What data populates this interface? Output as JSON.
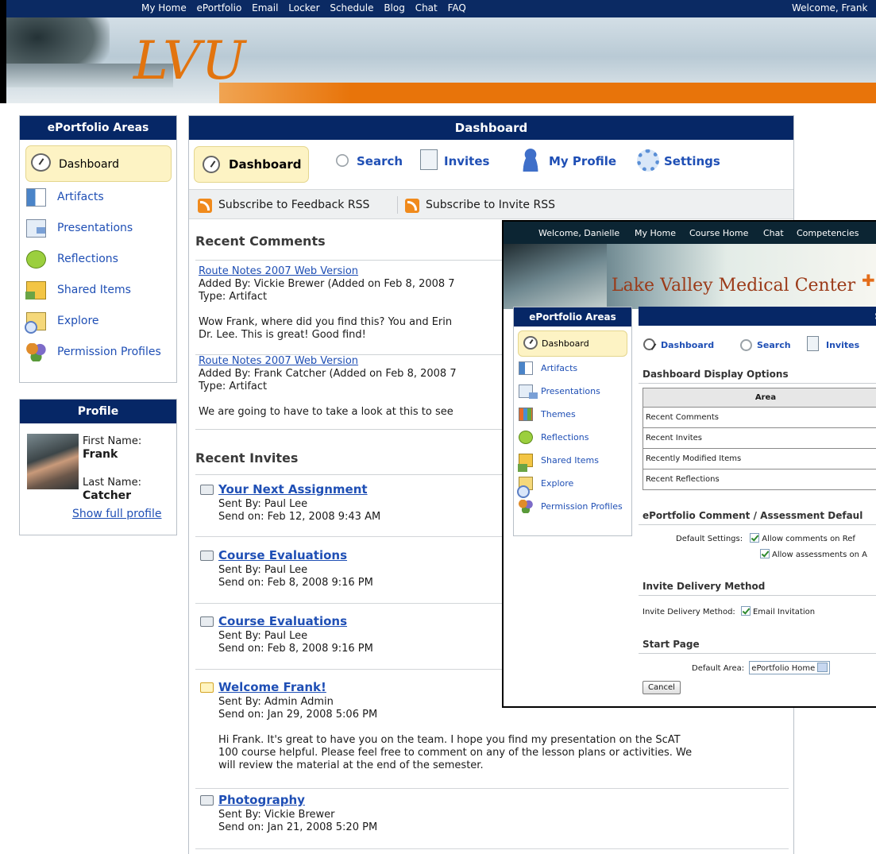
{
  "topnav": {
    "links": [
      "My Home",
      "ePortfolio",
      "Email",
      "Locker",
      "Schedule",
      "Blog",
      "Chat",
      "FAQ"
    ],
    "welcome": "Welcome, Frank"
  },
  "logo": "LVU",
  "areas": {
    "title": "ePortfolio Areas",
    "items": [
      {
        "label": "Dashboard",
        "icon": "dashboard-icon"
      },
      {
        "label": "Artifacts",
        "icon": "artifacts-icon"
      },
      {
        "label": "Presentations",
        "icon": "presentations-icon"
      },
      {
        "label": "Reflections",
        "icon": "reflections-icon"
      },
      {
        "label": "Shared Items",
        "icon": "shared-items-icon"
      },
      {
        "label": "Explore",
        "icon": "explore-icon"
      },
      {
        "label": "Permission Profiles",
        "icon": "permission-profiles-icon"
      }
    ]
  },
  "profile": {
    "title": "Profile",
    "first_label": "First Name:",
    "first_value": "Frank",
    "last_label": "Last Name:",
    "last_value": "Catcher",
    "full_link": "Show full profile"
  },
  "dashboard": {
    "title": "Dashboard",
    "toolbar": {
      "dashboard": "Dashboard",
      "search": "Search",
      "invites": "Invites",
      "profile": "My Profile",
      "settings": "Settings"
    },
    "rss": {
      "feedback": "Subscribe to Feedback RSS",
      "invite": "Subscribe to Invite RSS"
    },
    "recent_comments_title": "Recent Comments",
    "comments": [
      {
        "link": "Route Notes 2007 Web Version",
        "added": "Added By: Vickie Brewer (Added on Feb 8, 2008 7",
        "type": "Type: Artifact",
        "body1": "Wow Frank, where did you find this? You and Erin",
        "body2": "Dr. Lee. This is great! Good find!"
      },
      {
        "link": "Route Notes 2007 Web Version",
        "added": "Added By: Frank Catcher (Added on Feb 8, 2008 7",
        "type": "Type: Artifact",
        "body1": "We are going to have to take a look at this to see",
        "body2": ""
      }
    ],
    "recent_invites_title": "Recent Invites",
    "invites": [
      {
        "title": "Your Next Assignment",
        "sent_by": "Sent By: Paul Lee",
        "sent_on": "Send on: Feb 12, 2008 9:43 AM",
        "body": []
      },
      {
        "title": "Course Evaluations",
        "sent_by": "Sent By: Paul Lee",
        "sent_on": "Send on: Feb 8, 2008 9:16 PM",
        "body": []
      },
      {
        "title": "Course Evaluations",
        "sent_by": "Sent By: Paul Lee",
        "sent_on": "Send on: Feb 8, 2008 9:16 PM",
        "body": []
      },
      {
        "title": "Welcome Frank!",
        "sent_by": "Sent By: Admin Admin",
        "sent_on": "Send on: Jan 29, 2008 5:06 PM",
        "body": [
          "Hi Frank. It's great to have you on the team. I hope you find my presentation on the ScAT",
          "100 course helpful. Please feel free to comment on any of the lesson plans or activities. We",
          "will review the material at the end of the semester."
        ]
      },
      {
        "title": "Photography",
        "sent_by": "Sent By: Vickie Brewer",
        "sent_on": "Send on: Jan 21, 2008 5:20 PM",
        "body": []
      }
    ]
  },
  "overlay": {
    "nav": {
      "welcome": "Welcome, Danielle",
      "links": [
        "My Home",
        "Course Home",
        "Chat",
        "Competencies"
      ]
    },
    "title": "Lake Valley Medical Center",
    "areas_title": "ePortfolio Areas",
    "areas": [
      "Dashboard",
      "Artifacts",
      "Presentations",
      "Themes",
      "Reflections",
      "Shared Items",
      "Explore",
      "Permission Profiles"
    ],
    "main_title": "S",
    "toolbar": {
      "dashboard": "Dashboard",
      "search": "Search",
      "invites": "Invites"
    },
    "display_options_title": "Dashboard Display Options",
    "table_header": "Area",
    "table_rows": [
      "Recent Comments",
      "Recent Invites",
      "Recently Modified Items",
      "Recent Reflections"
    ],
    "comment_title": "ePortfolio Comment / Assessment Defaul",
    "default_settings_label": "Default Settings:",
    "allow_comments": "Allow comments on Ref",
    "allow_assessments": "Allow assessments on A",
    "invite_title": "Invite Delivery Method",
    "invite_label": "Invite Delivery Method:",
    "email_invitation": "Email Invitation",
    "start_title": "Start Page",
    "default_area_label": "Default Area:",
    "default_area_value": "ePortfolio Home",
    "cancel": "Cancel"
  }
}
